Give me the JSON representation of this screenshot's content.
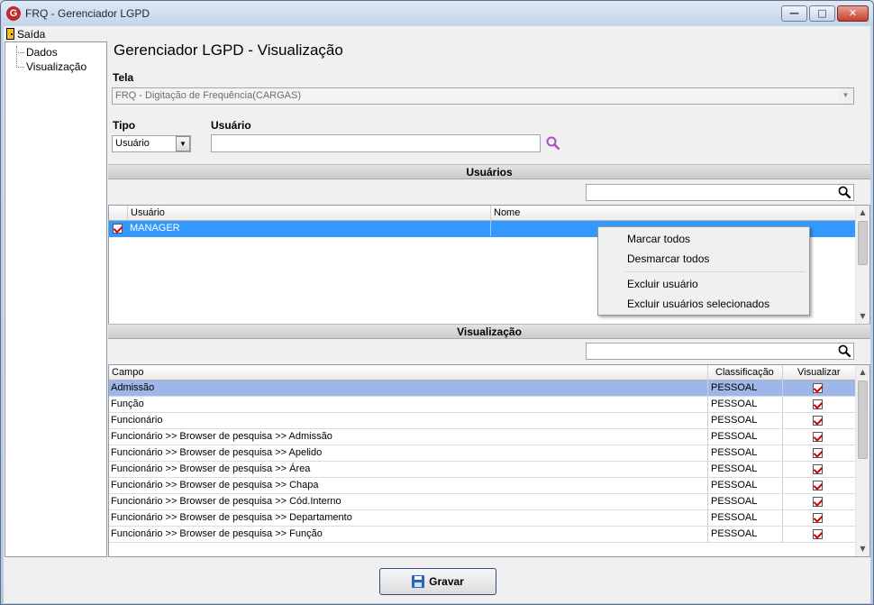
{
  "window": {
    "title": "FRQ - Gerenciador LGPD",
    "app_icon": "G"
  },
  "menu": {
    "exit_label": "Saída"
  },
  "tree": {
    "items": [
      "Dados",
      "Visualização"
    ]
  },
  "page": {
    "heading": "Gerenciador LGPD - Visualização"
  },
  "form": {
    "tela_label": "Tela",
    "tela_value": "FRQ - Digitação de Frequência(CARGAS)",
    "tipo_label": "Tipo",
    "tipo_value": "Usuário",
    "usuario_label": "Usuário",
    "usuario_value": ""
  },
  "users_section": {
    "title": "Usuários",
    "filter_value": "",
    "columns": [
      "Usuário",
      "Nome"
    ],
    "rows": [
      {
        "checked": true,
        "usuario": "MANAGER",
        "nome": ""
      }
    ]
  },
  "context_menu": {
    "items": [
      "Marcar todos",
      "Desmarcar todos",
      "Excluir usuário",
      "Excluir usuários selecionados"
    ]
  },
  "view_section": {
    "title": "Visualização",
    "filter_value": "",
    "columns": [
      "Campo",
      "Classificação",
      "Visualizar"
    ],
    "rows": [
      {
        "campo": "Admissão",
        "classificacao": "PESSOAL",
        "visualizar": true
      },
      {
        "campo": "Função",
        "classificacao": "PESSOAL",
        "visualizar": true
      },
      {
        "campo": "Funcionário",
        "classificacao": "PESSOAL",
        "visualizar": true
      },
      {
        "campo": "Funcionário >> Browser de pesquisa >> Admissão",
        "classificacao": "PESSOAL",
        "visualizar": true
      },
      {
        "campo": "Funcionário >> Browser de pesquisa >> Apelido",
        "classificacao": "PESSOAL",
        "visualizar": true
      },
      {
        "campo": "Funcionário >> Browser de pesquisa >> Área",
        "classificacao": "PESSOAL",
        "visualizar": true
      },
      {
        "campo": "Funcionário >> Browser de pesquisa >> Chapa",
        "classificacao": "PESSOAL",
        "visualizar": true
      },
      {
        "campo": "Funcionário >> Browser de pesquisa >> Cód.Interno",
        "classificacao": "PESSOAL",
        "visualizar": true
      },
      {
        "campo": "Funcionário >> Browser de pesquisa >> Departamento",
        "classificacao": "PESSOAL",
        "visualizar": true
      },
      {
        "campo": "Funcionário >> Browser de pesquisa >> Função",
        "classificacao": "PESSOAL",
        "visualizar": true
      }
    ]
  },
  "actions": {
    "save_label": "Gravar"
  },
  "colors": {
    "selection_blue": "#3399ff",
    "selection_soft": "#9fb6e8",
    "check_red": "#d00000",
    "search_lens": "#b04cc4"
  }
}
